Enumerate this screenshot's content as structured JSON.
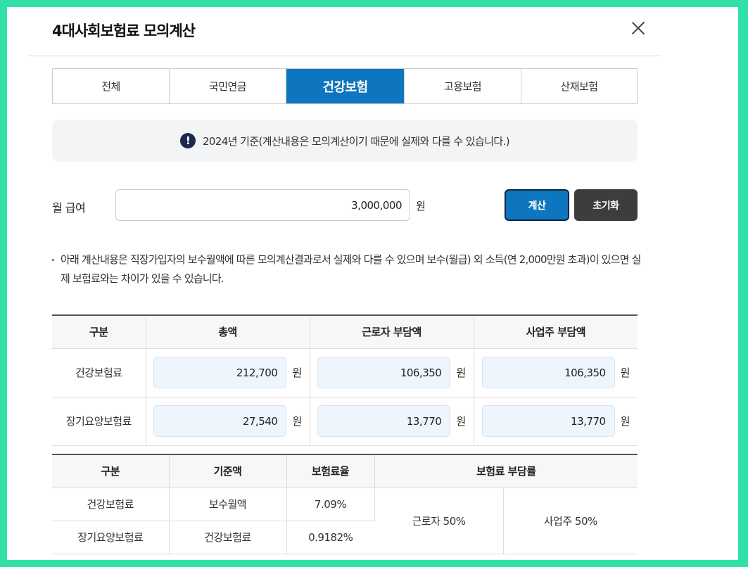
{
  "title": "4대사회보험료 모의계산",
  "tabs": [
    "전체",
    "국민연금",
    "건강보험",
    "고용보험",
    "산재보험"
  ],
  "active_tab": "건강보험",
  "notice": "2024년 기준(계산내용은 모의계산이기 때문에 실제와 다를 수 있습니다.)",
  "salary": {
    "label": "월 급여",
    "value": "3,000,000",
    "unit": "원"
  },
  "buttons": {
    "calc": "계산",
    "reset": "초기화"
  },
  "note": "아래 계산내용은 직장가입자의 보수월액에 따른 모의계산결과로서 실제와 다를 수 있으며 보수(월급) 외 소득(연 2,000만원 초과)이 있으면 실제 보험료와는 차이가 있을 수 있습니다.",
  "result_table": {
    "headers": [
      "구분",
      "총액",
      "근로자 부담액",
      "사업주 부담액"
    ],
    "unit": "원",
    "rows": [
      {
        "label": "건강보험료",
        "total": "212,700",
        "employee": "106,350",
        "employer": "106,350"
      },
      {
        "label": "장기요양보험료",
        "total": "27,540",
        "employee": "13,770",
        "employer": "13,770"
      }
    ]
  },
  "rate_table": {
    "headers": [
      "구분",
      "기준액",
      "보험료율",
      "보험료 부담률"
    ],
    "rows": [
      {
        "label": "건강보험료",
        "base": "보수월액",
        "rate": "7.09%"
      },
      {
        "label": "장기요양보험료",
        "base": "건강보험료",
        "rate": "0.9182%"
      }
    ],
    "share_employee": "근로자 50%",
    "share_employer": "사업주 50%"
  }
}
